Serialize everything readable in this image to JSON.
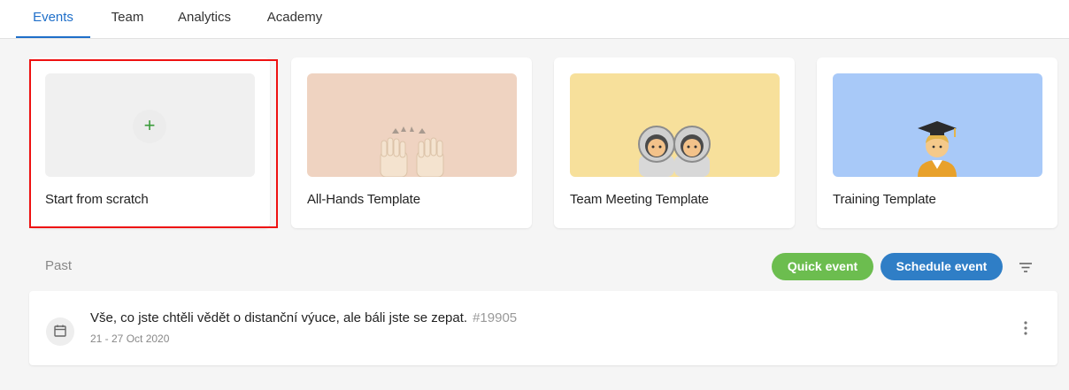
{
  "nav": {
    "tabs": [
      {
        "label": "Events",
        "active": true
      },
      {
        "label": "Team",
        "active": false
      },
      {
        "label": "Analytics",
        "active": false
      },
      {
        "label": "Academy",
        "active": false
      }
    ],
    "accent_color": "#1f6fc9"
  },
  "templates": [
    {
      "label": "Start from scratch",
      "icon": "plus-icon",
      "thumb_color": "#f0f0f0",
      "selected": true
    },
    {
      "label": "All-Hands Template",
      "icon": "raised-hands-icon",
      "thumb_color": "#efd3c1"
    },
    {
      "label": "Team Meeting Template",
      "icon": "astronauts-icon",
      "thumb_color": "#f7e09b"
    },
    {
      "label": "Training Template",
      "icon": "graduate-icon",
      "thumb_color": "#a8c9f8"
    }
  ],
  "past": {
    "label": "Past",
    "quick_event_label": "Quick event",
    "schedule_event_label": "Schedule event",
    "quick_color": "#6cbd4f",
    "schedule_color": "#2f7ec6"
  },
  "events": [
    {
      "title": "Vše, co jste chtěli vědět o distanční výuce, ale báli jste se zepat.",
      "id": "#19905",
      "dates": "21 - 27 Oct 2020",
      "icon": "calendar-icon"
    }
  ]
}
